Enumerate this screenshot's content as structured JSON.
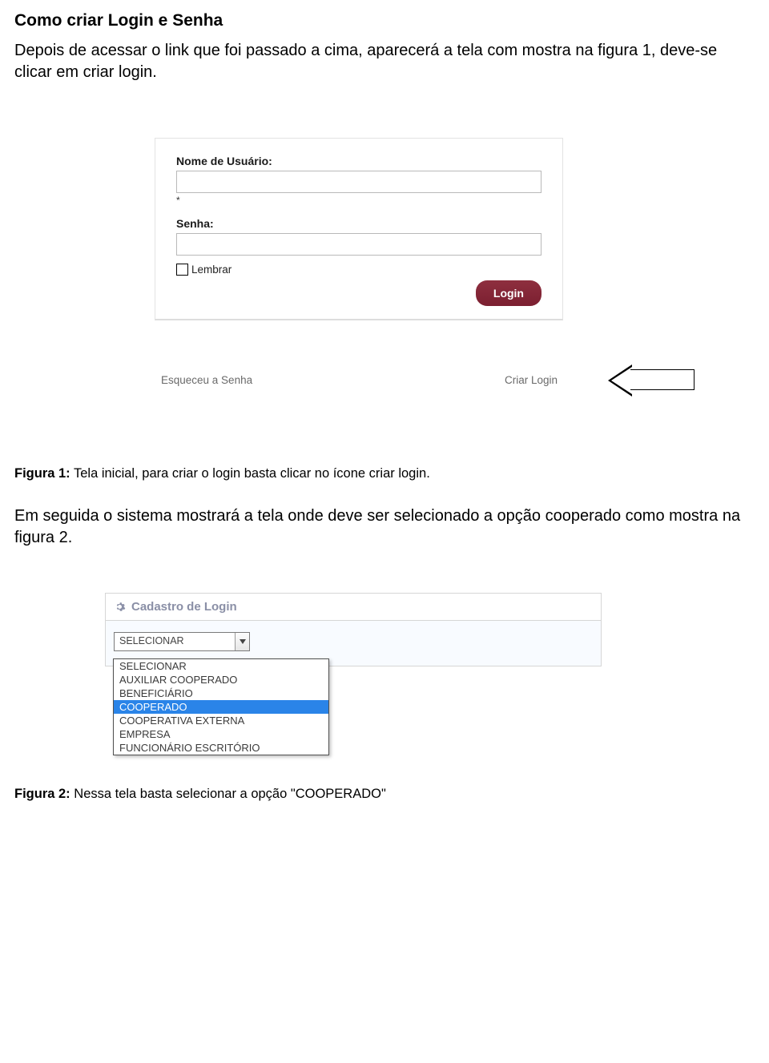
{
  "doc": {
    "title": "Como criar Login e Senha",
    "para1": "Depois de acessar o link que foi passado a cima, aparecerá a tela com mostra na figura 1, deve-se clicar em criar login.",
    "caption1_label": "Figura 1:",
    "caption1_text": " Tela inicial, para criar o login basta clicar no ícone criar login.",
    "para2": "Em seguida o sistema mostrará a tela onde deve ser selecionado a opção cooperado como mostra na figura 2.",
    "caption2_label": "Figura 2:",
    "caption2_text": " Nessa tela basta selecionar a opção \"COOPERADO\""
  },
  "login": {
    "username_label": "Nome de Usuário:",
    "asterisk": "*",
    "password_label": "Senha:",
    "remember": "Lembrar",
    "login_btn": "Login",
    "forgot": "Esqueceu a Senha",
    "create": "Criar Login"
  },
  "select": {
    "panel_title": "Cadastro de Login",
    "selected": "SELECIONAR",
    "options": {
      "0": "SELECIONAR",
      "1": "AUXILIAR COOPERADO",
      "2": "BENEFICIÁRIO",
      "3": "COOPERADO",
      "4": "COOPERATIVA EXTERNA",
      "5": "EMPRESA",
      "6": "FUNCIONÁRIO ESCRITÓRIO"
    }
  }
}
